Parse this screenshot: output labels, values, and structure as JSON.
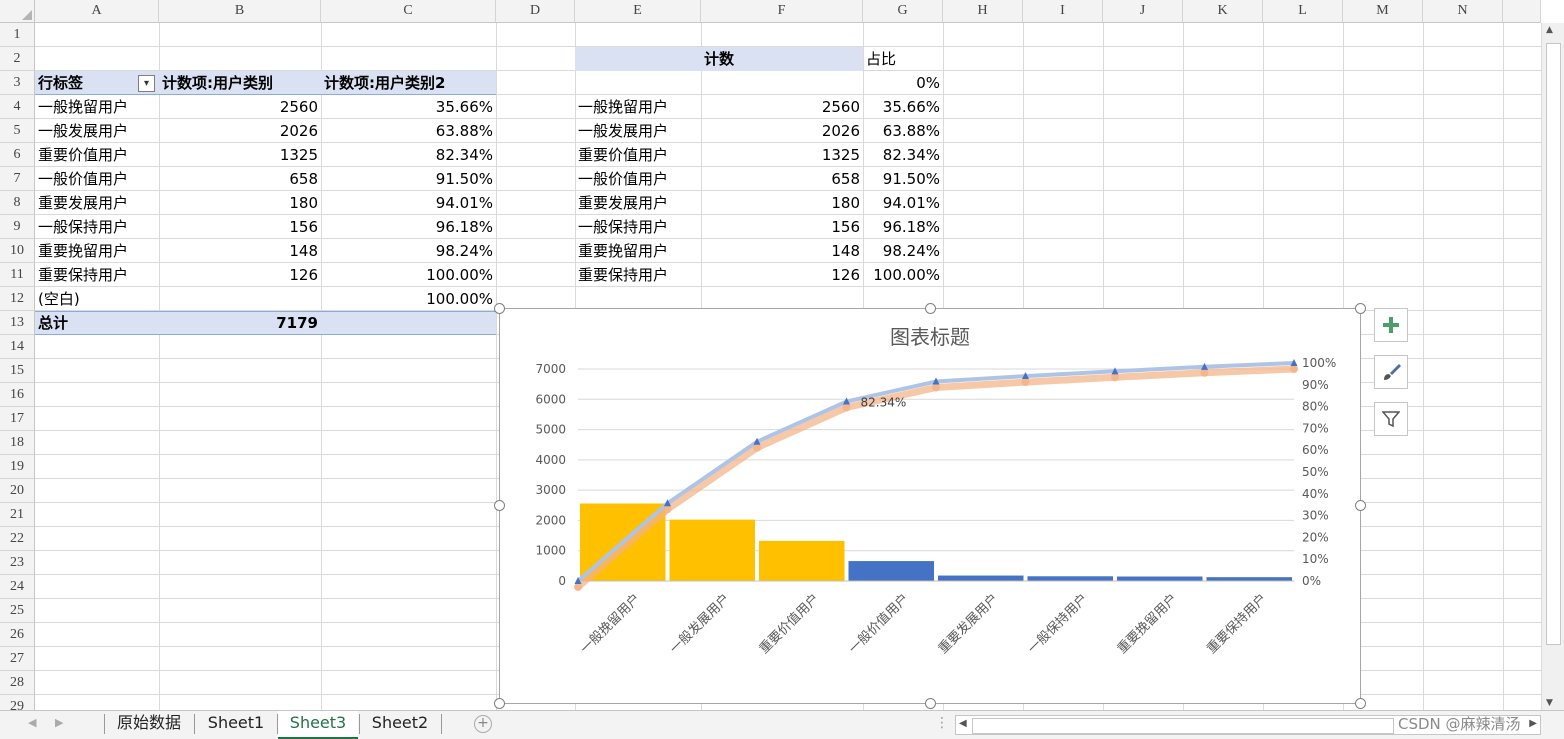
{
  "columns": [
    "A",
    "B",
    "C",
    "D",
    "E",
    "F",
    "G",
    "H",
    "I",
    "J",
    "K",
    "L",
    "M",
    "N"
  ],
  "rows": [
    "1",
    "2",
    "3",
    "4",
    "5",
    "6",
    "7",
    "8",
    "9",
    "10",
    "11",
    "12",
    "13",
    "14",
    "15",
    "16",
    "17",
    "18",
    "19",
    "20",
    "21",
    "22",
    "23",
    "24",
    "25",
    "26",
    "27",
    "28",
    "29"
  ],
  "pivot": {
    "header_row_label": "行标签",
    "header_count": "计数项:用户类别",
    "header_count2": "计数项:用户类别2",
    "rows": [
      {
        "label": "一般挽留用户",
        "count": "2560",
        "pct": "35.66%"
      },
      {
        "label": "一般发展用户",
        "count": "2026",
        "pct": "63.88%"
      },
      {
        "label": "重要价值用户",
        "count": "1325",
        "pct": "82.34%"
      },
      {
        "label": "一般价值用户",
        "count": "658",
        "pct": "91.50%"
      },
      {
        "label": "重要发展用户",
        "count": "180",
        "pct": "94.01%"
      },
      {
        "label": "一般保持用户",
        "count": "156",
        "pct": "96.18%"
      },
      {
        "label": "重要挽留用户",
        "count": "148",
        "pct": "98.24%"
      },
      {
        "label": "重要保持用户",
        "count": "126",
        "pct": "100.00%"
      }
    ],
    "blank_label": "(空白)",
    "blank_pct": "100.00%",
    "total_label": "总计",
    "total_value": "7179"
  },
  "table2": {
    "header_count": "计数",
    "header_ratio": "占比",
    "zero_pct": "0%",
    "rows": [
      {
        "label": "一般挽留用户",
        "count": "2560",
        "pct": "35.66%"
      },
      {
        "label": "一般发展用户",
        "count": "2026",
        "pct": "63.88%"
      },
      {
        "label": "重要价值用户",
        "count": "1325",
        "pct": "82.34%"
      },
      {
        "label": "一般价值用户",
        "count": "658",
        "pct": "91.50%"
      },
      {
        "label": "重要发展用户",
        "count": "180",
        "pct": "94.01%"
      },
      {
        "label": "一般保持用户",
        "count": "156",
        "pct": "96.18%"
      },
      {
        "label": "重要挽留用户",
        "count": "148",
        "pct": "98.24%"
      },
      {
        "label": "重要保持用户",
        "count": "126",
        "pct": "100.00%"
      }
    ]
  },
  "chart_data": {
    "type": "bar",
    "title": "图表标题",
    "categories": [
      "一般挽留用户",
      "一般发展用户",
      "重要价值用户",
      "一般价值用户",
      "重要发展用户",
      "一般保持用户",
      "重要挽留用户",
      "重要保持用户"
    ],
    "series": [
      {
        "type": "bar",
        "values": [
          2560,
          2026,
          1325,
          658,
          180,
          156,
          148,
          126
        ],
        "colors": [
          "#ffc000",
          "#ffc000",
          "#ffc000",
          "#4472c4",
          "#4472c4",
          "#4472c4",
          "#4472c4",
          "#4472c4"
        ]
      },
      {
        "type": "line",
        "axis": "right",
        "x": [
          0,
          1,
          2,
          3,
          4,
          5,
          6,
          7,
          8
        ],
        "values": [
          0,
          35.66,
          63.88,
          82.34,
          91.5,
          94.01,
          96.18,
          98.24,
          100.0
        ],
        "color": "#aec4e6",
        "marker_color": "#4472c4"
      }
    ],
    "ylim": [
      0,
      7000
    ],
    "yticks": [
      "0",
      "1000",
      "2000",
      "3000",
      "4000",
      "5000",
      "6000",
      "7000"
    ],
    "y2lim": [
      0,
      100
    ],
    "y2ticks": [
      "0%",
      "10%",
      "20%",
      "30%",
      "40%",
      "50%",
      "60%",
      "70%",
      "80%",
      "90%",
      "100%"
    ],
    "annotation": "82.34%",
    "grid": true
  },
  "sheet_tabs": [
    "原始数据",
    "Sheet1",
    "Sheet3",
    "Sheet2"
  ],
  "active_tab": "Sheet3",
  "watermark": "CSDN @麻辣清汤"
}
